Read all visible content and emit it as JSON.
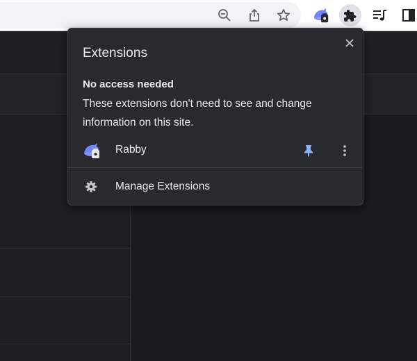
{
  "toolbar": {
    "icons": [
      "zoom-out-icon",
      "share-icon",
      "bookmark-star-icon",
      "rabby-extension-icon",
      "extensions-puzzle-icon",
      "media-queue-icon",
      "side-panel-icon"
    ]
  },
  "popup": {
    "title": "Extensions",
    "close_icon": "close-icon",
    "section_heading": "No access needed",
    "section_description": "These extensions don't need to see and change information on this site.",
    "extensions": [
      {
        "name": "Rabby",
        "icon": "rabby-icon",
        "pinned": true
      }
    ],
    "manage_label": "Manage Extensions",
    "manage_icon": "gear-icon"
  },
  "colors": {
    "popup_bg": "#292a2d",
    "popup_text": "#e8eaed",
    "pin_color": "#8ab4f8",
    "page_bg": "#1b1c20"
  }
}
